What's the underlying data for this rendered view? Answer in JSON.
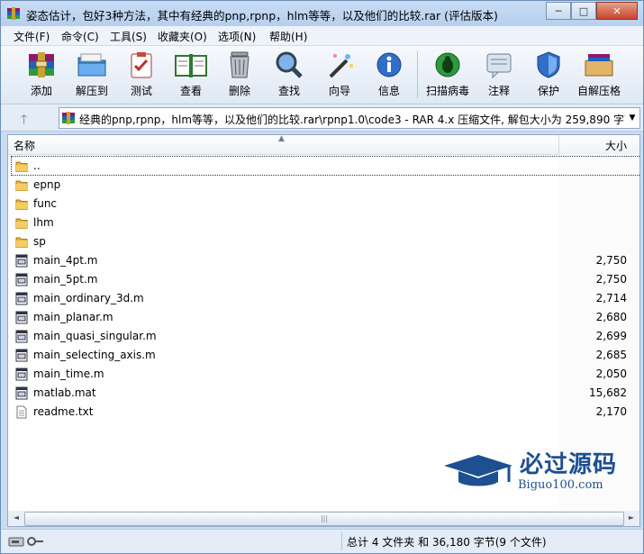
{
  "window": {
    "title": "姿态估计，包好3种方法，其中有经典的pnp,rpnp，hlm等等，以及他们的比较.rar (评估版本)",
    "controls": {
      "minimize": "─",
      "maximize": "□",
      "close": "✕"
    }
  },
  "menu": [
    {
      "label": "文件(F)"
    },
    {
      "label": "命令(C)"
    },
    {
      "label": "工具(S)"
    },
    {
      "label": "收藏夹(O)"
    },
    {
      "label": "选项(N)"
    },
    {
      "label": "帮助(H)"
    }
  ],
  "toolbar": [
    {
      "label": "添加",
      "icon": "add-archive-icon"
    },
    {
      "label": "解压到",
      "icon": "extract-folder-icon"
    },
    {
      "label": "测试",
      "icon": "test-clipboard-icon"
    },
    {
      "label": "查看",
      "icon": "view-book-icon"
    },
    {
      "label": "删除",
      "icon": "trash-icon"
    },
    {
      "label": "查找",
      "icon": "magnifier-icon"
    },
    {
      "label": "向导",
      "icon": "wizard-wand-icon"
    },
    {
      "label": "信息",
      "icon": "info-icon"
    },
    {
      "label": "扫描病毒",
      "icon": "virus-scan-icon"
    },
    {
      "label": "注释",
      "icon": "comment-icon"
    },
    {
      "label": "保护",
      "icon": "shield-icon"
    },
    {
      "label": "自解压格",
      "icon": "sfx-box-icon"
    }
  ],
  "address": {
    "up_arrow": "🡑",
    "path": "经典的pnp,rpnp，hlm等等，以及他们的比较.rar\\rpnp1.0\\code3 - RAR 4.x 压缩文件, 解包大小为 259,890 字节",
    "dropdown": "▼"
  },
  "columns": {
    "name": "名称",
    "size": "大小",
    "sort_indicator": "▲"
  },
  "files": [
    {
      "name": "..",
      "size": "",
      "type": "folder"
    },
    {
      "name": "epnp",
      "size": "",
      "type": "folder"
    },
    {
      "name": "func",
      "size": "",
      "type": "folder"
    },
    {
      "name": "lhm",
      "size": "",
      "type": "folder"
    },
    {
      "name": "sp",
      "size": "",
      "type": "folder"
    },
    {
      "name": "main_4pt.m",
      "size": "2,750",
      "type": "m"
    },
    {
      "name": "main_5pt.m",
      "size": "2,750",
      "type": "m"
    },
    {
      "name": "main_ordinary_3d.m",
      "size": "2,714",
      "type": "m"
    },
    {
      "name": "main_planar.m",
      "size": "2,680",
      "type": "m"
    },
    {
      "name": "main_quasi_singular.m",
      "size": "2,699",
      "type": "m"
    },
    {
      "name": "main_selecting_axis.m",
      "size": "2,685",
      "type": "m"
    },
    {
      "name": "main_time.m",
      "size": "2,050",
      "type": "m"
    },
    {
      "name": "matlab.mat",
      "size": "15,682",
      "type": "m"
    },
    {
      "name": "readme.txt",
      "size": "2,170",
      "type": "txt"
    }
  ],
  "watermark": {
    "cn": "必过源码",
    "en": "Biguo100.com"
  },
  "scrollbar": {
    "left": "◄",
    "right": "►",
    "grip": "|||"
  },
  "status": {
    "text": "总计 4 文件夹 和 36,180 字节(9 个文件)"
  }
}
